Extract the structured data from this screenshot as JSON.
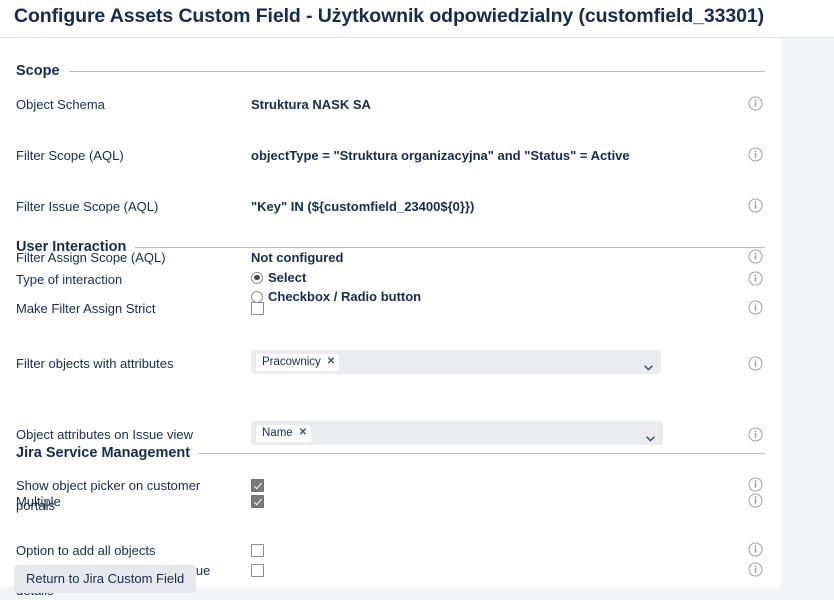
{
  "header": {
    "title": "Configure Assets Custom Field - Użytkownik odpowiedzialny (customfield_33301)"
  },
  "info_icon_name": "info-icon",
  "sections": {
    "scope": {
      "heading": "Scope",
      "rows": {
        "object_schema": {
          "label": "Object Schema",
          "value": "Struktura NASK SA"
        },
        "filter_scope": {
          "label": "Filter Scope (AQL)",
          "value": "objectType = \"Struktura organizacyjna\" and \"Status\" = Active"
        },
        "filter_issue_scope": {
          "label": "Filter Issue Scope (AQL)",
          "value": "\"Key\" IN (${customfield_23400${0}})"
        },
        "filter_assign_scope": {
          "label": "Filter Assign Scope (AQL)",
          "value": "Not configured"
        },
        "make_filter_assign_strict": {
          "label": "Make Filter Assign Strict",
          "checked": false
        }
      }
    },
    "user_interaction": {
      "heading": "User Interaction",
      "rows": {
        "type_of_interaction": {
          "label": "Type of interaction",
          "options": [
            {
              "label": "Select",
              "selected": true
            },
            {
              "label": "Checkbox / Radio button",
              "selected": false
            }
          ]
        },
        "filter_objects_with_attributes": {
          "label": "Filter objects with attributes",
          "tags": [
            "Pracownicy"
          ]
        },
        "object_attributes_on_issue_view": {
          "label": "Object attributes on Issue view",
          "tags": [
            "Name"
          ]
        },
        "multiple": {
          "label": "Multiple",
          "checked": true
        },
        "option_to_add_all_objects": {
          "label": "Option to add all objects",
          "checked": false
        }
      }
    },
    "jira_service_management": {
      "heading": "Jira Service Management",
      "rows": {
        "show_object_picker": {
          "label": "Show object picker on customer portals",
          "checked": true
        },
        "force_show_customer_issue": {
          "label": "Force to show on Customer Issue details",
          "checked": false
        }
      }
    }
  },
  "footer": {
    "return_button": "Return to Jira Custom Field"
  },
  "chip_remove_glyph": "✕",
  "colors": {
    "panel_background": "#ffffff",
    "page_background": "#f4f5f7",
    "text": "#172b4d",
    "rule": "#b9bcc2",
    "field_background": "#ebecf0",
    "button_background": "#e7e8ec"
  }
}
